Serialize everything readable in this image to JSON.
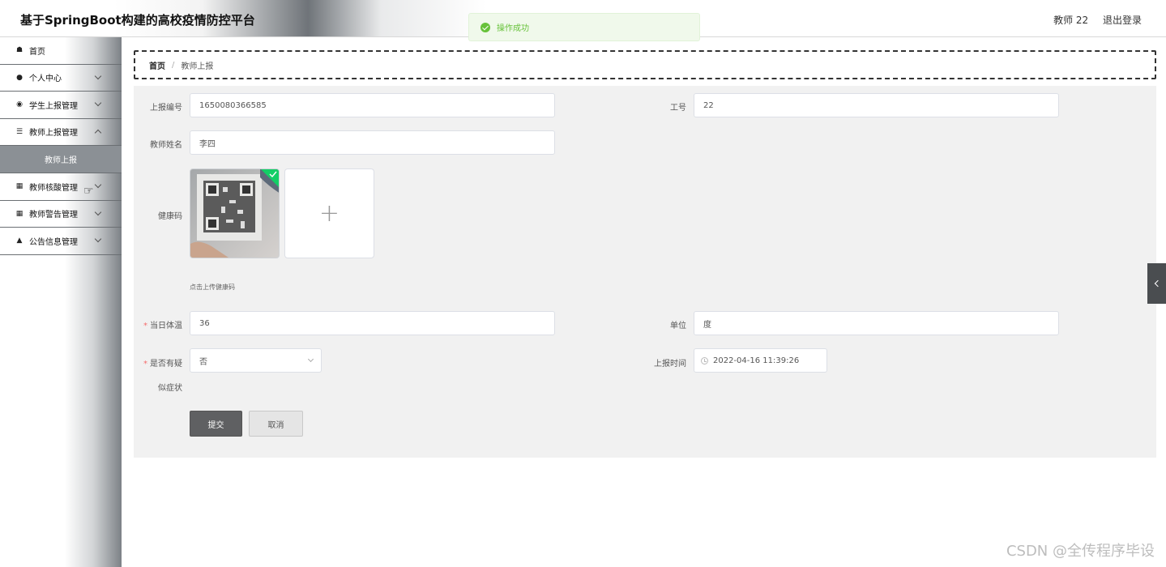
{
  "header": {
    "title": "基于SpringBoot构建的高校疫情防控平台",
    "user": "教师 22",
    "logout": "退出登录"
  },
  "toast": {
    "message": "操作成功",
    "color": "#67c23a"
  },
  "sidebar": {
    "items": [
      {
        "label": "首页",
        "icon": "home-icon"
      },
      {
        "label": "个人中心",
        "icon": "user-icon"
      },
      {
        "label": "学生上报管理",
        "icon": "location-pin-icon"
      },
      {
        "label": "教师上报管理",
        "icon": "sliders-icon"
      },
      {
        "label": "教师上报",
        "sub": true
      },
      {
        "label": "教师核酸管理",
        "icon": "grid-icon"
      },
      {
        "label": "教师警告管理",
        "icon": "grid-icon"
      },
      {
        "label": "公告信息管理",
        "icon": "person-stamp-icon"
      }
    ]
  },
  "breadcrumb": {
    "home": "首页",
    "separator": "/",
    "current": "教师上报"
  },
  "form": {
    "report_no_label": "上报编号",
    "report_no_value": "1650080366585",
    "staff_no_label": "工号",
    "staff_no_value": "22",
    "teacher_name_label": "教师姓名",
    "teacher_name_value": "李四",
    "health_code_label": "健康码",
    "upload_plus": "+",
    "upload_tip": "点击上传健康码",
    "temp_label": "当日体温",
    "temp_value": "36",
    "unit_label": "单位",
    "unit_value": "度",
    "symptom_label_line1": "是否有疑",
    "symptom_label_line2": "似症状",
    "symptom_value": "否",
    "report_time_label": "上报时间",
    "report_time_value": "2022-04-16 11:39:26",
    "required_mark": "*",
    "submit": "提交",
    "cancel": "取消"
  },
  "watermark": "CSDN @全传程序毕设"
}
